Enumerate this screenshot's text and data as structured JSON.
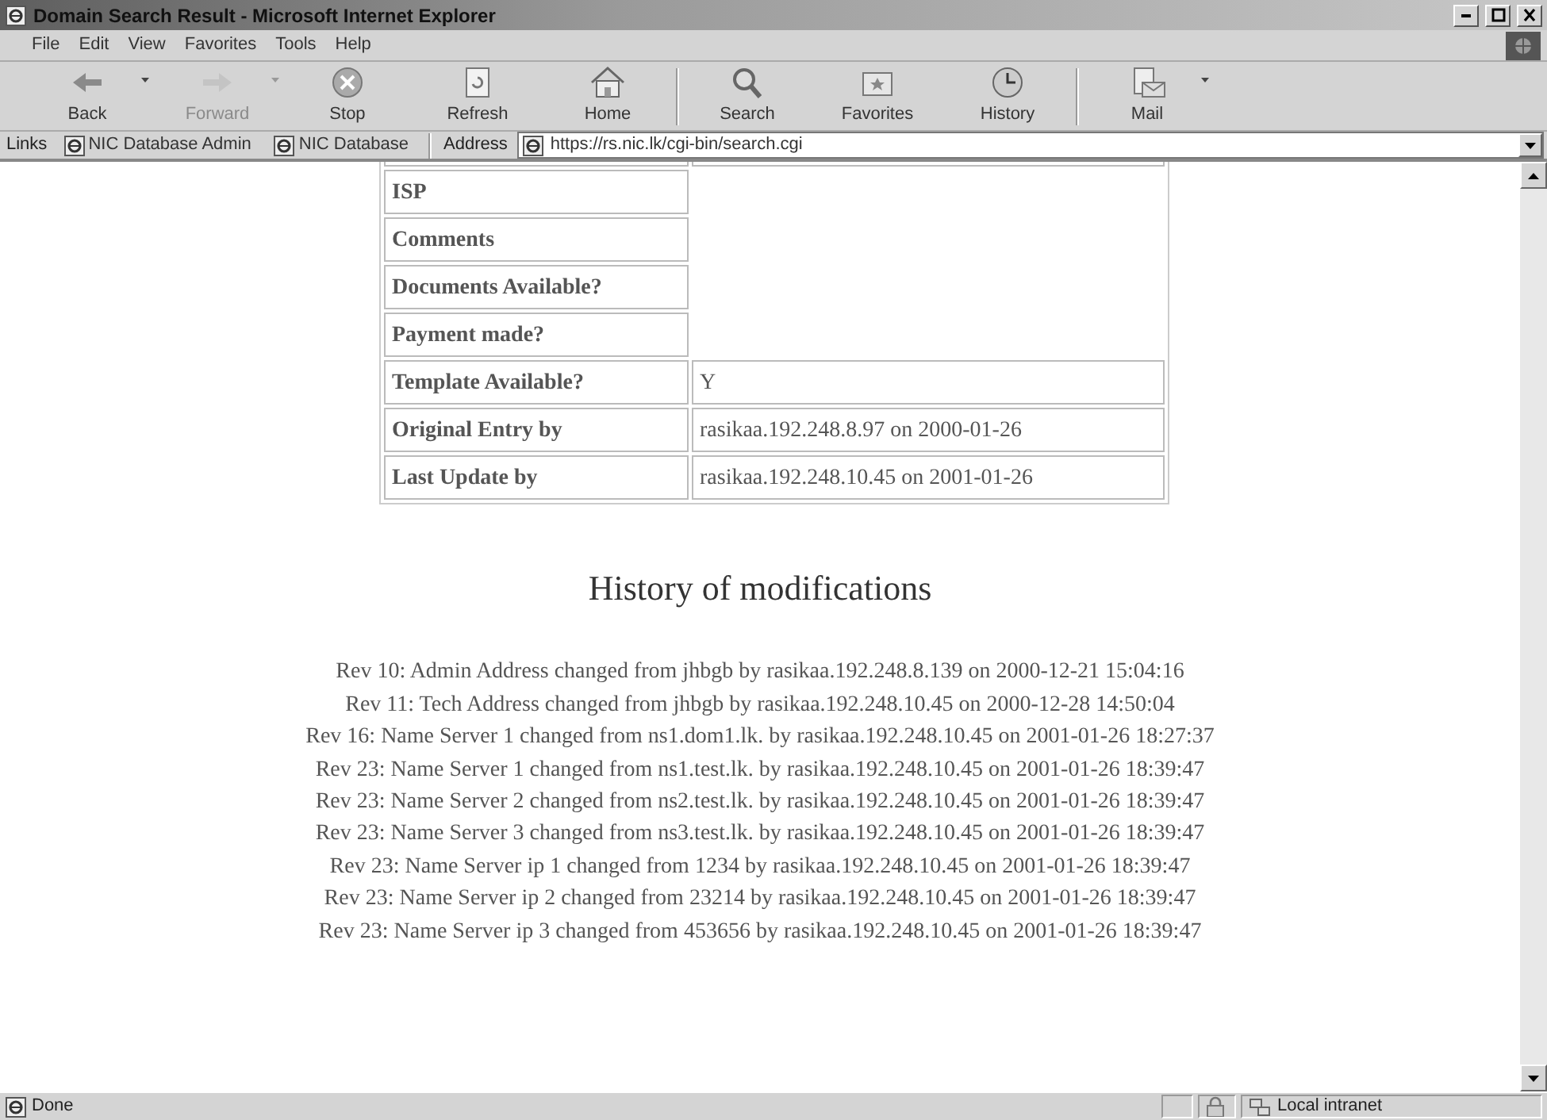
{
  "window": {
    "title": "Domain Search Result - Microsoft Internet Explorer"
  },
  "menu": [
    "File",
    "Edit",
    "View",
    "Favorites",
    "Tools",
    "Help"
  ],
  "toolbar": [
    {
      "kind": "back",
      "label": "Back",
      "disabled": false,
      "dropdown": true
    },
    {
      "kind": "forward",
      "label": "Forward",
      "disabled": true,
      "dropdown": true
    },
    {
      "kind": "stop",
      "label": "Stop",
      "disabled": false,
      "dropdown": false
    },
    {
      "kind": "refresh",
      "label": "Refresh",
      "disabled": false,
      "dropdown": false
    },
    {
      "kind": "home",
      "label": "Home",
      "disabled": false,
      "dropdown": false
    },
    {
      "kind": "search",
      "label": "Search",
      "disabled": false,
      "dropdown": false
    },
    {
      "kind": "favorites",
      "label": "Favorites",
      "disabled": false,
      "dropdown": false
    },
    {
      "kind": "history",
      "label": "History",
      "disabled": false,
      "dropdown": false
    },
    {
      "kind": "mail",
      "label": "Mail",
      "disabled": false,
      "dropdown": true
    }
  ],
  "links_bar": {
    "label": "Links",
    "links": [
      "NIC Database Admin",
      "NIC Database"
    ]
  },
  "address_bar": {
    "label": "Address",
    "value": "https://rs.nic.lk/cgi-bin/search.cgi"
  },
  "details_table": {
    "rows": [
      {
        "label": "ISP",
        "value": ""
      },
      {
        "label": "Comments",
        "value": ""
      },
      {
        "label": "Documents Available?",
        "value": ""
      },
      {
        "label": "Payment made?",
        "value": ""
      },
      {
        "label": "Template Available?",
        "value": "Y"
      },
      {
        "label": "Original Entry by",
        "value": "rasikaa.192.248.8.97 on 2000-01-26"
      },
      {
        "label": "Last Update by",
        "value": "rasikaa.192.248.10.45 on 2001-01-26"
      }
    ]
  },
  "history": {
    "heading": "History of modifications",
    "entries": [
      "Rev 10: Admin Address changed from jhbgb by rasikaa.192.248.8.139 on 2000-12-21 15:04:16",
      "Rev 11: Tech Address changed from jhbgb by rasikaa.192.248.10.45 on 2000-12-28 14:50:04",
      "Rev 16: Name Server 1 changed from ns1.dom1.lk. by rasikaa.192.248.10.45 on 2001-01-26 18:27:37",
      "Rev 23: Name Server 1 changed from ns1.test.lk. by rasikaa.192.248.10.45 on 2001-01-26 18:39:47",
      "Rev 23: Name Server 2 changed from ns2.test.lk. by rasikaa.192.248.10.45 on 2001-01-26 18:39:47",
      "Rev 23: Name Server 3 changed from ns3.test.lk. by rasikaa.192.248.10.45 on 2001-01-26 18:39:47",
      "Rev 23: Name Server ip 1 changed from 1234 by rasikaa.192.248.10.45 on 2001-01-26 18:39:47",
      "Rev 23: Name Server ip 2 changed from 23214 by rasikaa.192.248.10.45 on 2001-01-26 18:39:47",
      "Rev 23: Name Server ip 3 changed from 453656 by rasikaa.192.248.10.45 on 2001-01-26 18:39:47"
    ]
  },
  "status_bar": {
    "text": "Done",
    "zone": "Local intranet"
  }
}
